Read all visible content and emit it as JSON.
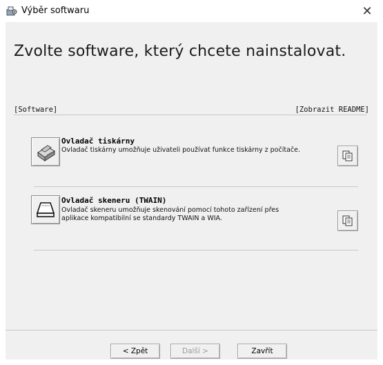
{
  "window": {
    "title": "Výběr softwaru",
    "close_glyph": "✕"
  },
  "heading": "Zvolte software, který chcete nainstalovat.",
  "group": {
    "left_label": "[Software]",
    "right_label": "[Zobrazit README]"
  },
  "items": [
    {
      "title": "Ovladač tiskárny",
      "description": "Ovladač tiskárny umožňuje uživateli používat funkce tiskárny z počítače.",
      "icon": "printer-icon",
      "readme_icon": "document-copy-icon"
    },
    {
      "title": "Ovladač skeneru (TWAIN)",
      "description": "Ovladač skeneru umožňuje skenování pomocí tohoto zařízení přes aplikace kompatibilní se standardy TWAIN a WIA.",
      "icon": "scanner-icon",
      "readme_icon": "document-copy-icon"
    }
  ],
  "buttons": {
    "back": "< Zpět",
    "next": "Další >",
    "close": "Zavřít"
  }
}
